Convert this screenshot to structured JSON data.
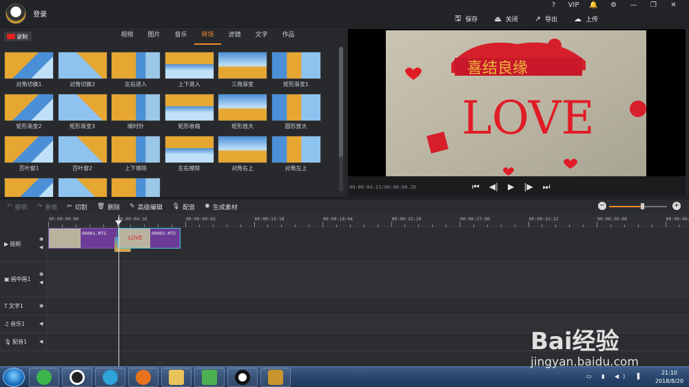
{
  "header": {
    "login": "登录",
    "window_icons": [
      "?",
      "VIP",
      "🔔",
      "⚙",
      "—",
      "❐",
      "✕"
    ],
    "actions": [
      {
        "icon": "save-icon",
        "glyph": "🖫",
        "label": "保存"
      },
      {
        "icon": "close-project-icon",
        "glyph": "⏏",
        "label": "关闭"
      },
      {
        "icon": "export-icon",
        "glyph": "↗",
        "label": "导出"
      },
      {
        "icon": "upload-icon",
        "glyph": "☁",
        "label": "上传"
      }
    ]
  },
  "media": {
    "record_label": "录制",
    "tabs": [
      "视频",
      "图片",
      "音乐",
      "转场",
      "滤镜",
      "文字",
      "作品"
    ],
    "active_tab": 3,
    "transitions": [
      "对角切换1",
      "对角切换2",
      "左右进入",
      "上下进入",
      "三角渐变",
      "矩形渐变1",
      "矩形渐变2",
      "矩形渐变3",
      "顺时针",
      "矩形收缩",
      "矩形放大",
      "圆形放大",
      "百叶窗1",
      "百叶窗2",
      "上下擦除",
      "左右擦除",
      "对角右上",
      "对角左上",
      "",
      "",
      ""
    ]
  },
  "preview": {
    "timecode": "00:00:04.21/00:00:08.26",
    "controls": [
      "⏮",
      "◀|",
      "▶",
      "|▶",
      "⏭"
    ]
  },
  "edit_toolbar": [
    {
      "icon": "undo-icon",
      "glyph": "↶",
      "label": "撤销",
      "disabled": true
    },
    {
      "icon": "redo-icon",
      "glyph": "↷",
      "label": "重做",
      "disabled": true
    },
    {
      "icon": "cut-icon",
      "glyph": "✂",
      "label": "切割",
      "disabled": false
    },
    {
      "icon": "delete-icon",
      "glyph": "🗑",
      "label": "删除",
      "disabled": false
    },
    {
      "icon": "edit-icon",
      "glyph": "✎",
      "label": "高级编辑",
      "disabled": false
    },
    {
      "icon": "microphone-icon",
      "glyph": "🎙",
      "label": "配音",
      "disabled": false
    },
    {
      "icon": "generate-icon",
      "glyph": "✺",
      "label": "生成素材",
      "disabled": false
    }
  ],
  "zoom_level": 0.55,
  "timeline": {
    "ruler": [
      "00:00:00:00",
      "00:00:04:16",
      "00:00:09:02",
      "00:00:13:18",
      "00:00:18:04",
      "00:00:22:20",
      "00:00:27:06",
      "00:00:31:22",
      "00:00:36:08",
      "00:00:40:"
    ],
    "tracks": [
      {
        "name": "视频",
        "glyph": "▶"
      },
      {
        "name": "画中画1",
        "glyph": "▣"
      },
      {
        "name": "文字1",
        "glyph": "T"
      },
      {
        "name": "音乐1",
        "glyph": "♫"
      },
      {
        "name": "配音1",
        "glyph": "🎙"
      }
    ],
    "clips": [
      "00001.MTS",
      "00002.MTS"
    ],
    "clip_thumb_text": "LOVE"
  },
  "taskbar": {
    "time": "21:10",
    "date": "2018/8/20",
    "tray": "▭ ▮ ◀) ▐"
  },
  "watermark": {
    "brand": "Bai经验",
    "url": "jingyan.baidu.com"
  }
}
